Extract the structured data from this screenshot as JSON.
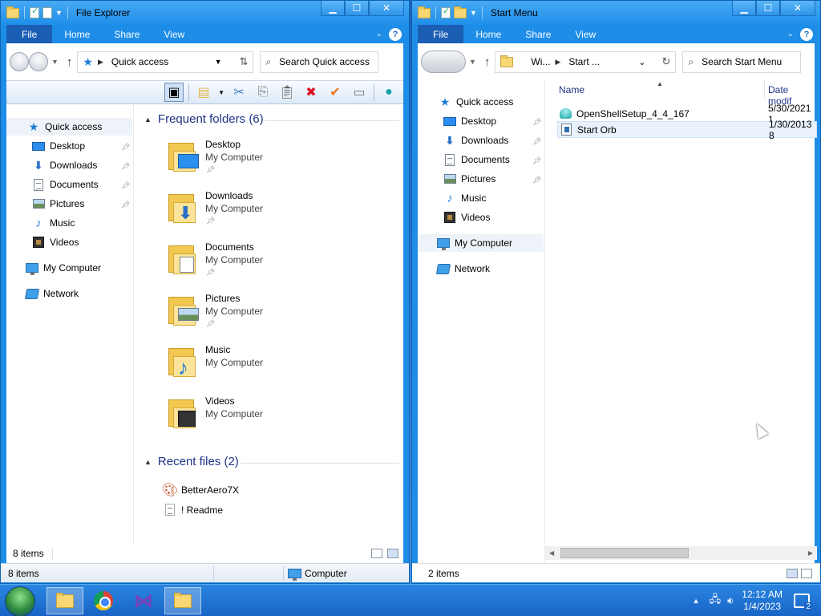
{
  "left_window": {
    "title": "File Explorer",
    "tabs": [
      "File",
      "Home",
      "Share",
      "View"
    ],
    "address": "Quick access",
    "search_placeholder": "Search Quick access",
    "nav": [
      {
        "label": "Quick access",
        "icon": "star-icon"
      },
      {
        "label": "Desktop",
        "icon": "desktop-icon",
        "pinned": true
      },
      {
        "label": "Downloads",
        "icon": "download-icon",
        "pinned": true
      },
      {
        "label": "Documents",
        "icon": "document-icon",
        "pinned": true
      },
      {
        "label": "Pictures",
        "icon": "pictures-icon",
        "pinned": true
      },
      {
        "label": "Music",
        "icon": "music-icon"
      },
      {
        "label": "Videos",
        "icon": "video-icon"
      },
      {
        "label": "My Computer",
        "icon": "computer-icon"
      },
      {
        "label": "Network",
        "icon": "network-icon"
      }
    ],
    "frequent_header": "Frequent folders (6)",
    "frequent": [
      {
        "name": "Desktop",
        "location": "My Computer"
      },
      {
        "name": "Downloads",
        "location": "My Computer"
      },
      {
        "name": "Documents",
        "location": "My Computer"
      },
      {
        "name": "Pictures",
        "location": "My Computer"
      },
      {
        "name": "Music",
        "location": "My Computer"
      },
      {
        "name": "Videos",
        "location": "My Computer"
      }
    ],
    "recent_header": "Recent files (2)",
    "recent": [
      "BetterAero7X",
      "! Readme"
    ],
    "status_inner": "8 items",
    "status_outer_count": "8 items",
    "status_outer_location": "Computer"
  },
  "right_window": {
    "title": "Start Menu",
    "tabs": [
      "File",
      "Home",
      "Share",
      "View"
    ],
    "address_parts": [
      "Wi...",
      "Start ..."
    ],
    "search_placeholder": "Search Start Menu",
    "nav": [
      {
        "label": "Quick access",
        "icon": "star-icon"
      },
      {
        "label": "Desktop",
        "icon": "desktop-icon",
        "pinned": true
      },
      {
        "label": "Downloads",
        "icon": "download-icon",
        "pinned": true
      },
      {
        "label": "Documents",
        "icon": "document-icon",
        "pinned": true
      },
      {
        "label": "Pictures",
        "icon": "pictures-icon",
        "pinned": true
      },
      {
        "label": "Music",
        "icon": "music-icon"
      },
      {
        "label": "Videos",
        "icon": "video-icon"
      },
      {
        "label": "My Computer",
        "icon": "computer-icon"
      },
      {
        "label": "Network",
        "icon": "network-icon"
      }
    ],
    "columns": [
      "Name",
      "Date modif"
    ],
    "files": [
      {
        "name": "OpenShellSetup_4_4_167",
        "date": "5/30/2021 1"
      },
      {
        "name": "Start Orb",
        "date": "1/30/2013 8"
      }
    ],
    "status": "2 items"
  },
  "taskbar": {
    "time": "12:12 AM",
    "date": "1/4/2023",
    "notification_count": "2"
  },
  "colors": {
    "titlebar": "#1d8de8",
    "file_tab": "#1a5fb4",
    "taskbar": "#1864c6",
    "nav_text_heading": "#1e3287"
  }
}
